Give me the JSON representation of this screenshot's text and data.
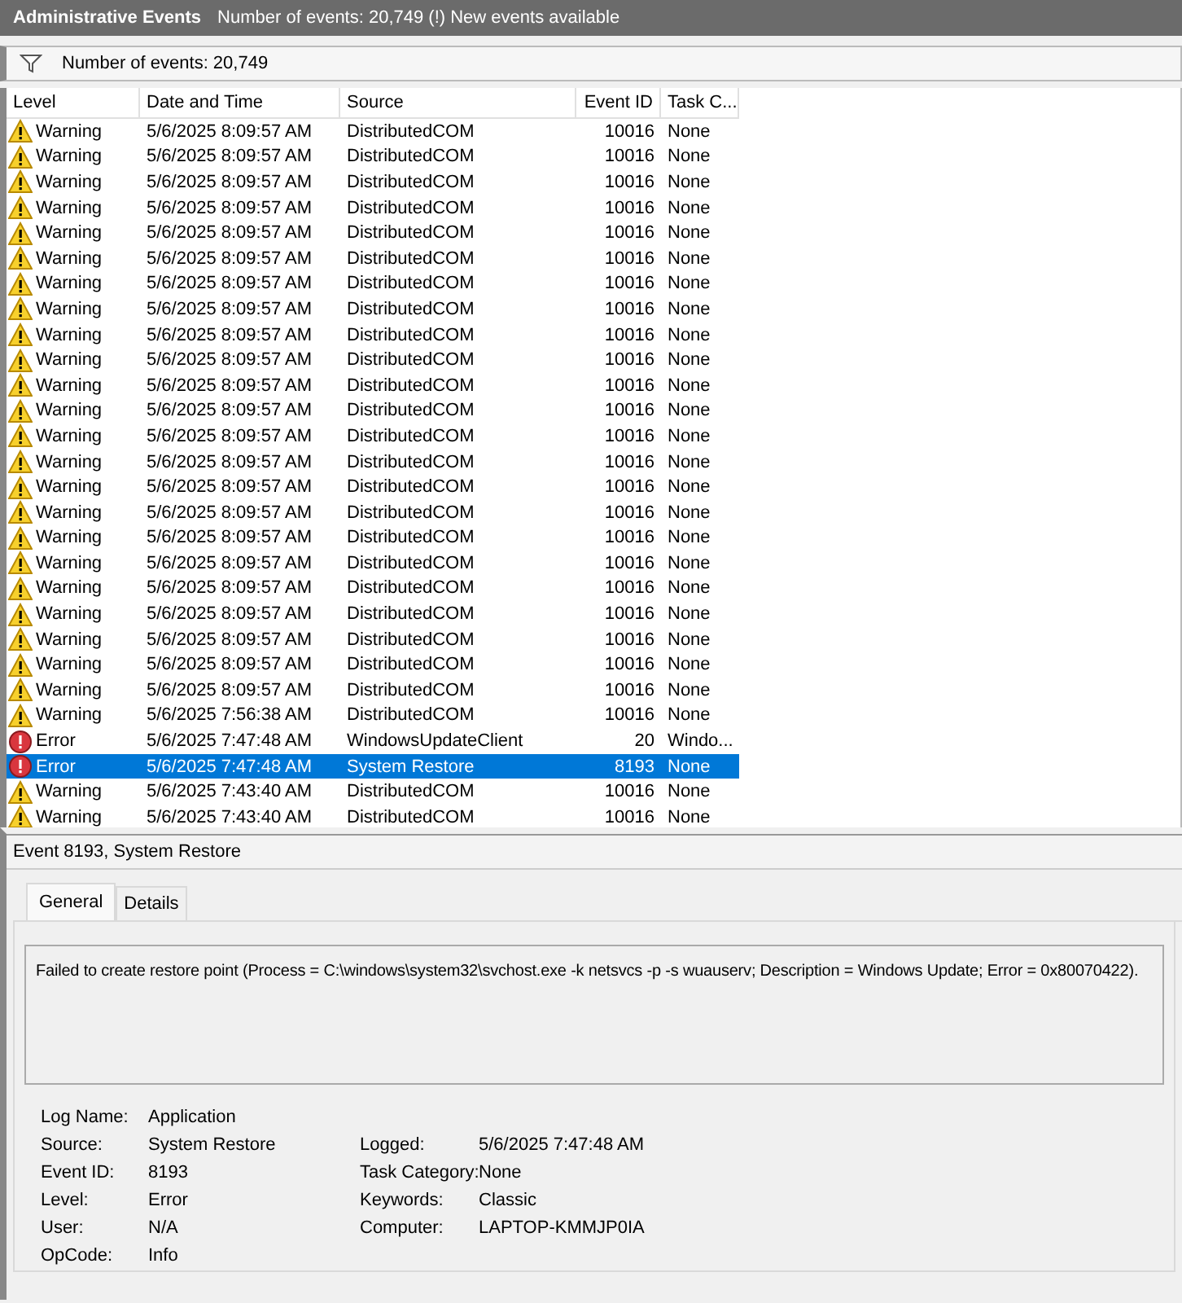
{
  "title_bar": {
    "title": "Administrative Events",
    "info": "Number of events: 20,749 (!) New events available"
  },
  "filter_bar": {
    "text": "Number of events: 20,749"
  },
  "table": {
    "columns": [
      "Level",
      "Date and Time",
      "Source",
      "Event ID",
      "Task C..."
    ],
    "rows": [
      {
        "kind": "warning",
        "level": "Warning",
        "date": "5/6/2025 8:09:57 AM",
        "source": "DistributedCOM",
        "event_id": "10016",
        "task_category": "None",
        "selected": false
      },
      {
        "kind": "warning",
        "level": "Warning",
        "date": "5/6/2025 8:09:57 AM",
        "source": "DistributedCOM",
        "event_id": "10016",
        "task_category": "None",
        "selected": false
      },
      {
        "kind": "warning",
        "level": "Warning",
        "date": "5/6/2025 8:09:57 AM",
        "source": "DistributedCOM",
        "event_id": "10016",
        "task_category": "None",
        "selected": false
      },
      {
        "kind": "warning",
        "level": "Warning",
        "date": "5/6/2025 8:09:57 AM",
        "source": "DistributedCOM",
        "event_id": "10016",
        "task_category": "None",
        "selected": false
      },
      {
        "kind": "warning",
        "level": "Warning",
        "date": "5/6/2025 8:09:57 AM",
        "source": "DistributedCOM",
        "event_id": "10016",
        "task_category": "None",
        "selected": false
      },
      {
        "kind": "warning",
        "level": "Warning",
        "date": "5/6/2025 8:09:57 AM",
        "source": "DistributedCOM",
        "event_id": "10016",
        "task_category": "None",
        "selected": false
      },
      {
        "kind": "warning",
        "level": "Warning",
        "date": "5/6/2025 8:09:57 AM",
        "source": "DistributedCOM",
        "event_id": "10016",
        "task_category": "None",
        "selected": false
      },
      {
        "kind": "warning",
        "level": "Warning",
        "date": "5/6/2025 8:09:57 AM",
        "source": "DistributedCOM",
        "event_id": "10016",
        "task_category": "None",
        "selected": false
      },
      {
        "kind": "warning",
        "level": "Warning",
        "date": "5/6/2025 8:09:57 AM",
        "source": "DistributedCOM",
        "event_id": "10016",
        "task_category": "None",
        "selected": false
      },
      {
        "kind": "warning",
        "level": "Warning",
        "date": "5/6/2025 8:09:57 AM",
        "source": "DistributedCOM",
        "event_id": "10016",
        "task_category": "None",
        "selected": false
      },
      {
        "kind": "warning",
        "level": "Warning",
        "date": "5/6/2025 8:09:57 AM",
        "source": "DistributedCOM",
        "event_id": "10016",
        "task_category": "None",
        "selected": false
      },
      {
        "kind": "warning",
        "level": "Warning",
        "date": "5/6/2025 8:09:57 AM",
        "source": "DistributedCOM",
        "event_id": "10016",
        "task_category": "None",
        "selected": false
      },
      {
        "kind": "warning",
        "level": "Warning",
        "date": "5/6/2025 8:09:57 AM",
        "source": "DistributedCOM",
        "event_id": "10016",
        "task_category": "None",
        "selected": false
      },
      {
        "kind": "warning",
        "level": "Warning",
        "date": "5/6/2025 8:09:57 AM",
        "source": "DistributedCOM",
        "event_id": "10016",
        "task_category": "None",
        "selected": false
      },
      {
        "kind": "warning",
        "level": "Warning",
        "date": "5/6/2025 8:09:57 AM",
        "source": "DistributedCOM",
        "event_id": "10016",
        "task_category": "None",
        "selected": false
      },
      {
        "kind": "warning",
        "level": "Warning",
        "date": "5/6/2025 8:09:57 AM",
        "source": "DistributedCOM",
        "event_id": "10016",
        "task_category": "None",
        "selected": false
      },
      {
        "kind": "warning",
        "level": "Warning",
        "date": "5/6/2025 8:09:57 AM",
        "source": "DistributedCOM",
        "event_id": "10016",
        "task_category": "None",
        "selected": false
      },
      {
        "kind": "warning",
        "level": "Warning",
        "date": "5/6/2025 8:09:57 AM",
        "source": "DistributedCOM",
        "event_id": "10016",
        "task_category": "None",
        "selected": false
      },
      {
        "kind": "warning",
        "level": "Warning",
        "date": "5/6/2025 8:09:57 AM",
        "source": "DistributedCOM",
        "event_id": "10016",
        "task_category": "None",
        "selected": false
      },
      {
        "kind": "warning",
        "level": "Warning",
        "date": "5/6/2025 8:09:57 AM",
        "source": "DistributedCOM",
        "event_id": "10016",
        "task_category": "None",
        "selected": false
      },
      {
        "kind": "warning",
        "level": "Warning",
        "date": "5/6/2025 8:09:57 AM",
        "source": "DistributedCOM",
        "event_id": "10016",
        "task_category": "None",
        "selected": false
      },
      {
        "kind": "warning",
        "level": "Warning",
        "date": "5/6/2025 8:09:57 AM",
        "source": "DistributedCOM",
        "event_id": "10016",
        "task_category": "None",
        "selected": false
      },
      {
        "kind": "warning",
        "level": "Warning",
        "date": "5/6/2025 8:09:57 AM",
        "source": "DistributedCOM",
        "event_id": "10016",
        "task_category": "None",
        "selected": false
      },
      {
        "kind": "warning",
        "level": "Warning",
        "date": "5/6/2025 7:56:38 AM",
        "source": "DistributedCOM",
        "event_id": "10016",
        "task_category": "None",
        "selected": false
      },
      {
        "kind": "error",
        "level": "Error",
        "date": "5/6/2025 7:47:48 AM",
        "source": "WindowsUpdateClient",
        "event_id": "20",
        "task_category": "Windo...",
        "selected": false
      },
      {
        "kind": "error",
        "level": "Error",
        "date": "5/6/2025 7:47:48 AM",
        "source": "System Restore",
        "event_id": "8193",
        "task_category": "None",
        "selected": true
      },
      {
        "kind": "warning",
        "level": "Warning",
        "date": "5/6/2025 7:43:40 AM",
        "source": "DistributedCOM",
        "event_id": "10016",
        "task_category": "None",
        "selected": false
      },
      {
        "kind": "warning",
        "level": "Warning",
        "date": "5/6/2025 7:43:40 AM",
        "source": "DistributedCOM",
        "event_id": "10016",
        "task_category": "None",
        "selected": false
      }
    ]
  },
  "details": {
    "heading": "Event 8193, System Restore",
    "tabs": [
      {
        "label": "General",
        "selected": true
      },
      {
        "label": "Details",
        "selected": false
      }
    ],
    "message": "Failed to create restore point (Process = C:\\windows\\system32\\svchost.exe -k netsvcs -p -s wuauserv; Description = Windows Update; Error = 0x80070422).",
    "properties_left": [
      {
        "label": "Log Name:",
        "value": "Application"
      },
      {
        "label": "Source:",
        "value": "System Restore"
      },
      {
        "label": "Event ID:",
        "value": "8193"
      },
      {
        "label": "Level:",
        "value": "Error"
      },
      {
        "label": "User:",
        "value": "N/A"
      },
      {
        "label": "OpCode:",
        "value": "Info"
      }
    ],
    "properties_right": [
      {
        "label": "Logged:",
        "value": "5/6/2025 7:47:48 AM"
      },
      {
        "label": "Task Category:",
        "value": "None"
      },
      {
        "label": "Keywords:",
        "value": "Classic"
      },
      {
        "label": "Computer:",
        "value": "LAPTOP-KMMJP0IA"
      }
    ]
  }
}
